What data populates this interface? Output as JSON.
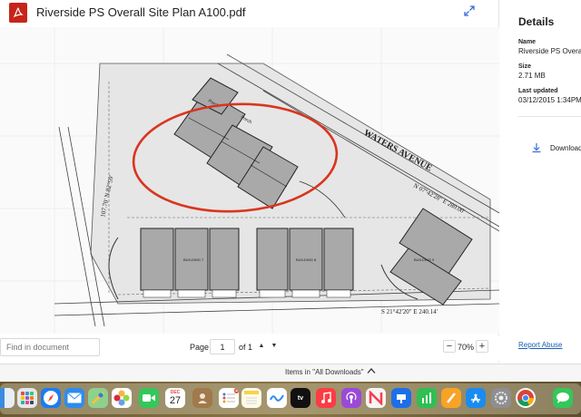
{
  "viewer": {
    "file_title": "Riverside PS Overall Site Plan A100.pdf",
    "icon": "pdf-icon",
    "expand_icon": "expand-icon"
  },
  "drawing": {
    "street_name": "WATERS AVENUE",
    "bearing_top": "N 07°42'28\" E  280.00'",
    "bearing_bottom": "S 21°42'20\" E  240.14'",
    "bearing_left": "107.70'  N 82°59'",
    "building_left": "BUILDING 7",
    "building_mid": "BUILDING 8",
    "building_right": "BUILDING 9",
    "porch_left": "Porch",
    "porch_right": "Porch",
    "highlight_color": "#d9351f"
  },
  "toolbar": {
    "find_placeholder": "Find in document",
    "page_label": "Page",
    "page_value": "1",
    "page_of": "of 1",
    "page_up": "▲",
    "page_down": "▼",
    "zoom_out": "−",
    "zoom_level": "70%",
    "zoom_in": "+"
  },
  "details": {
    "heading": "Details",
    "name_label": "Name",
    "name_value": "Riverside PS Overal",
    "size_label": "Size",
    "size_value": "2.71 MB",
    "updated_label": "Last updated",
    "updated_value": "03/12/2015 1:34PM",
    "download_label": "Download",
    "report_label": "Report Abuse"
  },
  "downloads": {
    "label": "Items in \"All Downloads\""
  },
  "dock": {
    "calendar_month": "DEC",
    "calendar_day": "27",
    "reminders_badge": "2",
    "apps": [
      "finder-icon",
      "launchpad-icon",
      "safari-icon",
      "mail-icon",
      "maps-icon",
      "photos-icon",
      "facetime-icon",
      "calendar-icon",
      "contacts-icon",
      "reminders-icon",
      "notes-icon",
      "freeform-icon",
      "appletv-icon",
      "music-icon",
      "podcasts-icon",
      "news-icon",
      "keynote-icon",
      "numbers-icon",
      "pages-icon",
      "appstore-icon",
      "settings-icon",
      "chrome-icon",
      "messages-icon"
    ]
  },
  "colors": {
    "pdf_red": "#c7251b",
    "link_blue": "#1a5fb4",
    "accent_blue": "#3a6fd8"
  }
}
